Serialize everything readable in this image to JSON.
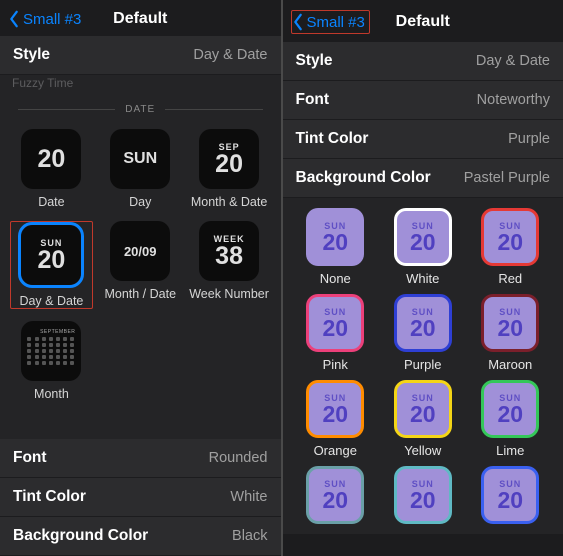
{
  "left": {
    "back": "Small #3",
    "title": "Default",
    "style": {
      "l": "Style",
      "r": "Day & Date"
    },
    "fuzzy": "Fuzzy Time",
    "divider": "DATE",
    "cells": {
      "c0": {
        "caption": "Date",
        "big": "20"
      },
      "c1": {
        "caption": "Day",
        "big": "SUN"
      },
      "c2": {
        "caption": "Month & Date",
        "top": "SEP",
        "big": "20"
      },
      "c3": {
        "caption": "Day & Date",
        "top": "SUN",
        "big": "20"
      },
      "c4": {
        "caption": "Month / Date",
        "mid": "20/09"
      },
      "c5": {
        "caption": "Week Number",
        "top": "WEEK",
        "big": "38"
      },
      "c6": {
        "caption": "Month",
        "mc_top": "SEPTEMBER"
      }
    },
    "rows": {
      "font": {
        "l": "Font",
        "r": "Rounded"
      },
      "tint": {
        "l": "Tint Color",
        "r": "White"
      },
      "bg": {
        "l": "Background Color",
        "r": "Black"
      }
    }
  },
  "right": {
    "back": "Small #3",
    "title": "Default",
    "rows": {
      "style": {
        "l": "Style",
        "r": "Day & Date"
      },
      "font": {
        "l": "Font",
        "r": "Noteworthy"
      },
      "tint": {
        "l": "Tint Color",
        "r": "Purple"
      },
      "bg": {
        "l": "Background Color",
        "r": "Pastel Purple"
      }
    },
    "preview": {
      "top": "SUN",
      "big": "20"
    },
    "colors": [
      {
        "name": "None",
        "border": "transparent"
      },
      {
        "name": "White",
        "border": "#ffffff"
      },
      {
        "name": "Red",
        "border": "#e53935"
      },
      {
        "name": "Pink",
        "border": "#ec407a"
      },
      {
        "name": "Purple",
        "border": "#2e3fd4"
      },
      {
        "name": "Maroon",
        "border": "#7b1f2b"
      },
      {
        "name": "Orange",
        "border": "#ff8c00"
      },
      {
        "name": "Yellow",
        "border": "#f4d516"
      },
      {
        "name": "Lime",
        "border": "#34c759"
      },
      {
        "name": "",
        "border": "#6aa0a8"
      },
      {
        "name": "",
        "border": "#5fb9c4"
      },
      {
        "name": "",
        "border": "#3a60f0"
      }
    ]
  }
}
